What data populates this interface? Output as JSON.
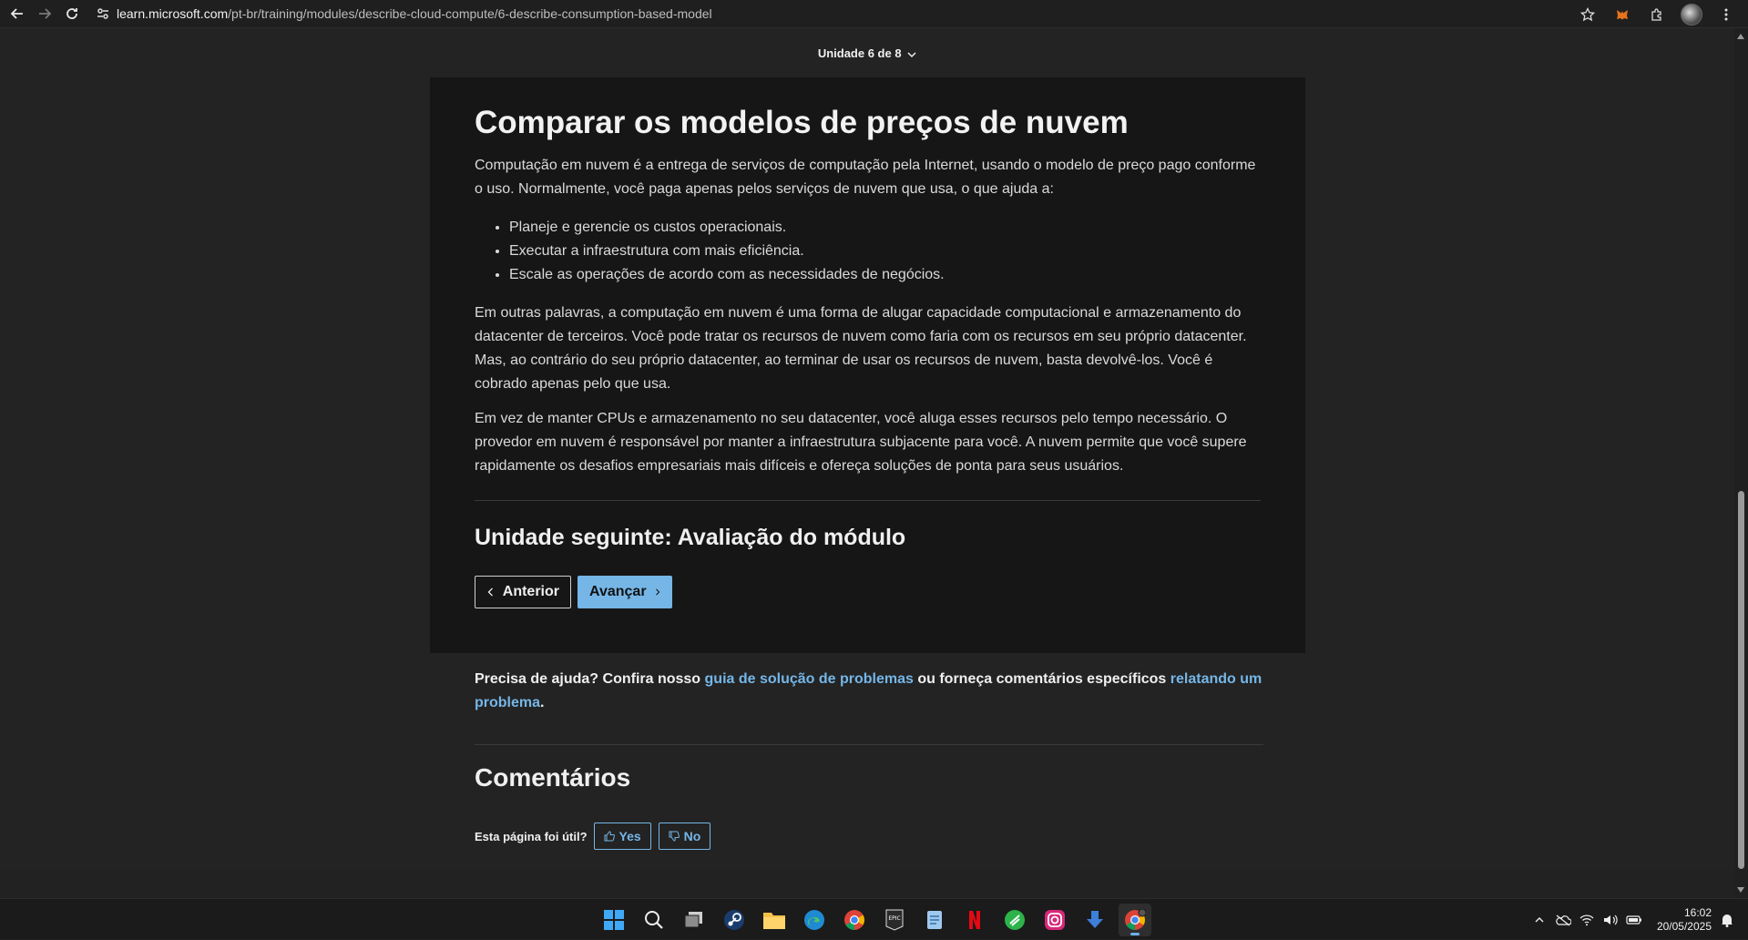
{
  "browser": {
    "url_host": "learn.microsoft.com",
    "url_path": "/pt-br/training/modules/describe-cloud-compute/6-describe-consumption-based-model"
  },
  "unit_nav": {
    "label": "Unidade 6 de 8"
  },
  "article": {
    "title": "Comparar os modelos de preços de nuvem",
    "intro": "Computação em nuvem é a entrega de serviços de computação pela Internet, usando o modelo de preço pago conforme o uso. Normalmente, você paga apenas pelos serviços de nuvem que usa, o que ajuda a:",
    "bullets": [
      "Planeje e gerencie os custos operacionais.",
      "Executar a infraestrutura com mais eficiência.",
      "Escale as operações de acordo com as necessidades de negócios."
    ],
    "para2": "Em outras palavras, a computação em nuvem é uma forma de alugar capacidade computacional e armazenamento do datacenter de terceiros. Você pode tratar os recursos de nuvem como faria com os recursos em seu próprio datacenter. Mas, ao contrário do seu próprio datacenter, ao terminar de usar os recursos de nuvem, basta devolvê-los. Você é cobrado apenas pelo que usa.",
    "para3": "Em vez de manter CPUs e armazenamento no seu datacenter, você aluga esses recursos pelo tempo necessário. O provedor em nuvem é responsável por manter a infraestrutura subjacente para você. A nuvem permite que você supere rapidamente os desafios empresariais mais difíceis e ofereça soluções de ponta para seus usuários.",
    "next_unit": "Unidade seguinte: Avaliação do módulo",
    "prev_label": "Anterior",
    "next_label": "Avançar"
  },
  "help": {
    "prefix": "Precisa de ajuda? Confira nosso ",
    "link1": "guia de solução de problemas",
    "middle": " ou forneça comentários específicos ",
    "link2": "relatando um problema",
    "suffix": "."
  },
  "comments": {
    "title": "Comentários",
    "question": "Esta página foi útil?",
    "yes": "Yes",
    "no": "No"
  },
  "taskbar": {
    "apps": [
      "start-icon",
      "search-icon",
      "task-view-icon",
      "steam-icon",
      "file-explorer-icon",
      "edge-icon",
      "chrome-icon",
      "epic-games-icon",
      "notepad-icon",
      "netflix-icon",
      "sheets-app-icon",
      "instagram-icon",
      "download-app-icon",
      "chrome-active-icon"
    ],
    "time": "16:02",
    "date": "20/05/2025"
  },
  "colors": {
    "link": "#75b6e7",
    "page_bg": "#232323",
    "card_bg": "#161616",
    "footer": "#0d2237"
  }
}
